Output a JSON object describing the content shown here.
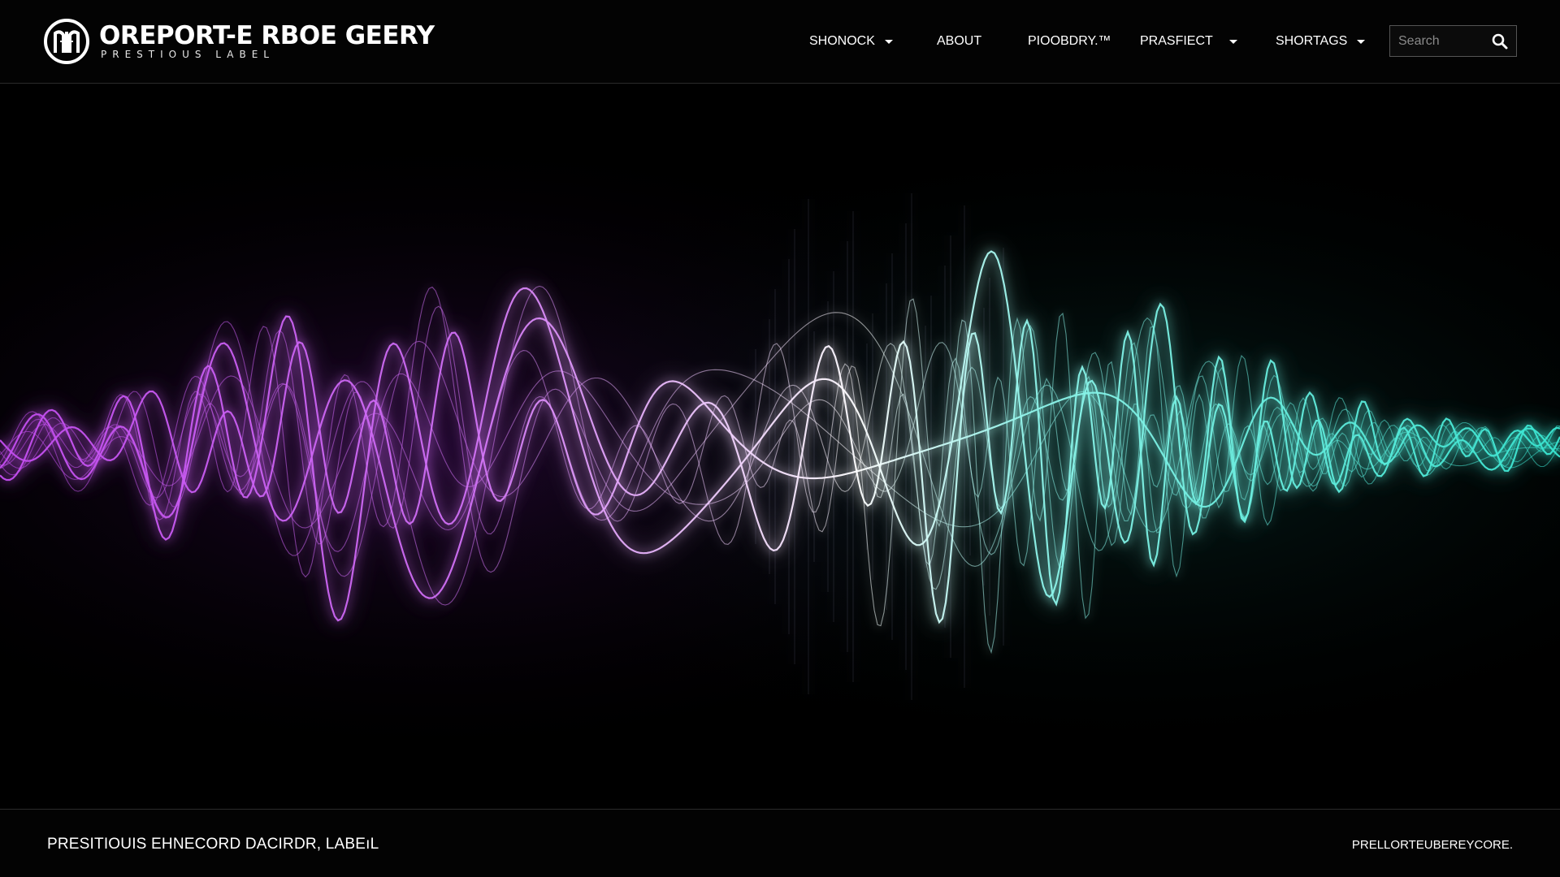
{
  "brand": {
    "title": "OREPORT-E RBOE GEERY",
    "subtitle": "PRESTIOUS LABEL"
  },
  "nav": {
    "items": [
      {
        "label": "SHONOCK",
        "has_dropdown": true
      },
      {
        "label": "ABOUT",
        "has_dropdown": false
      },
      {
        "label": "PIOOBDRY.™",
        "has_dropdown": false
      },
      {
        "label": "PRASFIECT",
        "has_dropdown": true
      },
      {
        "label": "SHORTAGS",
        "has_dropdown": true
      }
    ]
  },
  "search": {
    "placeholder": "Search",
    "value": "",
    "icon": "magnifier"
  },
  "hero": {
    "image": "sound-waveform",
    "colors": {
      "left": "#c34cf0",
      "center": "#ffffff",
      "right": "#38e4d0",
      "background": "#000000"
    }
  },
  "footer": {
    "left_text": "PRESITIOUIS EHNECORD DACIRDR, LABEıL",
    "right_text": "PRELLORTEUBEREYCORE."
  }
}
